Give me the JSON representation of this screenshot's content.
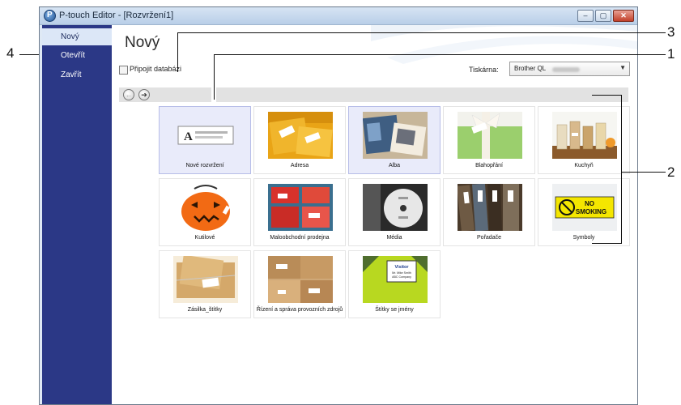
{
  "window": {
    "title": "P-touch Editor - [Rozvržení1]",
    "controls": {
      "minimize": "–",
      "maximize": "▢",
      "close": "✕"
    }
  },
  "nav": {
    "items": [
      {
        "label": "Nový",
        "selected": true
      },
      {
        "label": "Otevřít",
        "selected": false
      },
      {
        "label": "Zavřít",
        "selected": false
      }
    ]
  },
  "main": {
    "title": "Nový",
    "connect_db_label": "Připojit databázi",
    "connect_db_checked": false,
    "printer_label": "Tiskárna:",
    "printer_value": "Brother QL",
    "back_arrow": "←",
    "forward_arrow": "➔",
    "dropdown_arrow": "▼"
  },
  "tiles": [
    {
      "label": "Nové rozvržení",
      "selected": true
    },
    {
      "label": "Adresa"
    },
    {
      "label": "Alba"
    },
    {
      "label": "Blahopřání"
    },
    {
      "label": "Kuchyň"
    },
    {
      "label": "Kutilové"
    },
    {
      "label": "Maloobchodní prodejna"
    },
    {
      "label": "Média"
    },
    {
      "label": "Pořadače"
    },
    {
      "label": "Symboly"
    },
    {
      "label": "Zásilka_štítky"
    },
    {
      "label": "Řízení a správa provozních zdrojů"
    },
    {
      "label": "Štítky se jmény"
    }
  ],
  "callouts": {
    "c1": "1",
    "c2": "2",
    "c3": "3",
    "c4": "4"
  },
  "thumb_text": {
    "new_layout_letter": "A",
    "no_smoking_line1": "NO",
    "no_smoking_line2": "SMOKING",
    "visitor_line1": "Visitor",
    "visitor_line2": "Mr. Mike Smith",
    "visitor_line3": "ABC Company"
  },
  "colors": {
    "nav_bg": "#2b3886",
    "nav_selected_bg": "#dce7f7",
    "selected_tile_bg": "#e9ebfa",
    "titlebar": "#c9dbef",
    "close_button": "#c2402a"
  }
}
